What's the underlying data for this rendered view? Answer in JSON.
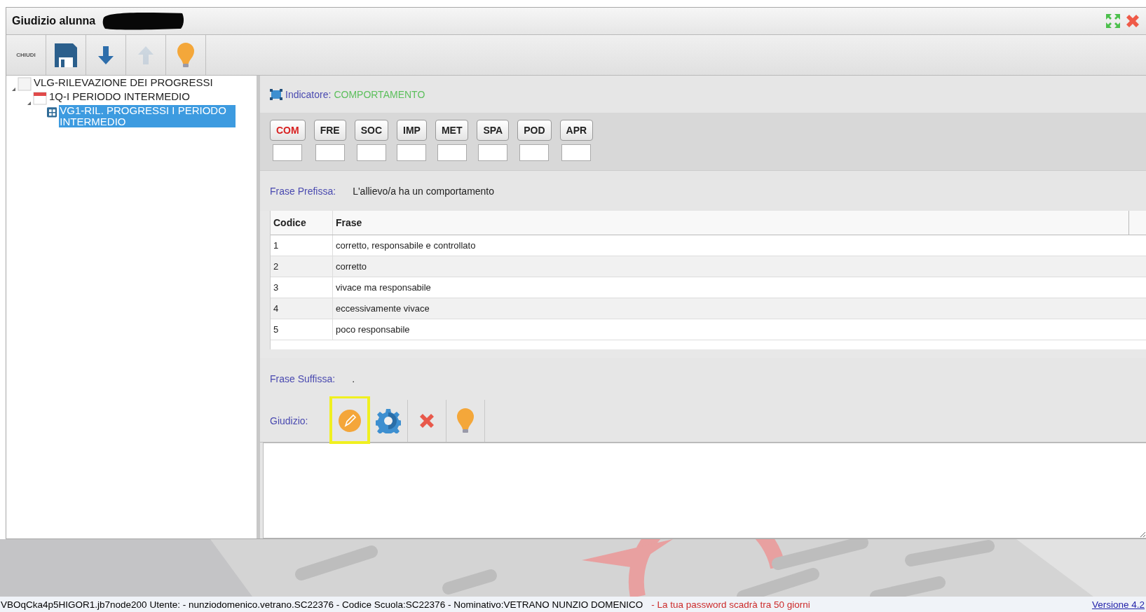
{
  "window": {
    "title": "Giudizio alunna",
    "redacted": true
  },
  "window_controls": [
    {
      "kind": "maximize"
    },
    {
      "kind": "close"
    }
  ],
  "toolbar": [
    {
      "kind": "close-text",
      "label": "CHIUDI",
      "disabled": false
    },
    {
      "kind": "save",
      "disabled": false
    },
    {
      "kind": "down",
      "disabled": false
    },
    {
      "kind": "up",
      "disabled": true
    },
    {
      "kind": "hint",
      "disabled": false
    }
  ],
  "tree": [
    {
      "label": "VLG-RILEVAZIONE DEI PROGRESSI",
      "kind": "page",
      "expanded": true,
      "selected": false,
      "children": [
        {
          "label": "1Q-I PERIODO INTERMEDIO",
          "kind": "calendar",
          "expanded": true,
          "selected": false,
          "children": [
            {
              "label": "VG1-RIL. PROGRESSI I PERIODO INTERMEDIO",
              "kind": "grid",
              "selected": true
            }
          ]
        }
      ]
    }
  ],
  "indicator": {
    "label": "Indicatore:",
    "value": "COMPORTAMENTO"
  },
  "codes": [
    {
      "label": "COM",
      "selected": true
    },
    {
      "label": "FRE",
      "selected": false
    },
    {
      "label": "SOC",
      "selected": false
    },
    {
      "label": "IMP",
      "selected": false
    },
    {
      "label": "MET",
      "selected": false
    },
    {
      "label": "SPA",
      "selected": false
    },
    {
      "label": "POD",
      "selected": false
    },
    {
      "label": "APR",
      "selected": false
    }
  ],
  "prefix": {
    "label": "Frase Prefissa:",
    "value": "L'allievo/a ha un comportamento"
  },
  "table": {
    "columns": [
      "Codice",
      "Frase"
    ],
    "rows": [
      [
        "1",
        "corretto, responsabile e controllato"
      ],
      [
        "2",
        "corretto"
      ],
      [
        "3",
        "vivace ma responsabile"
      ],
      [
        "4",
        "eccessivamente vivace"
      ],
      [
        "5",
        "poco responsabile"
      ]
    ]
  },
  "suffix": {
    "label": "Frase Suffissa:",
    "value": "."
  },
  "judgement": {
    "label": "Giudizio:",
    "tools": [
      {
        "kind": "edit",
        "highlighted": true
      },
      {
        "kind": "gear",
        "highlighted": false
      },
      {
        "kind": "delete",
        "highlighted": false
      },
      {
        "kind": "hint",
        "highlighted": false
      }
    ]
  },
  "status_bar": {
    "session": "VBOqCka4p5HIGOR1.jb7node200 Utente: - nunziodomenico.vetrano.SC22376 - Codice Scuola:SC22376 - Nominativo:VETRANO NUNZIO DOMENICO",
    "warning": "- La tua password scadrà tra 50 giorni",
    "version": "Versione 4.2"
  }
}
